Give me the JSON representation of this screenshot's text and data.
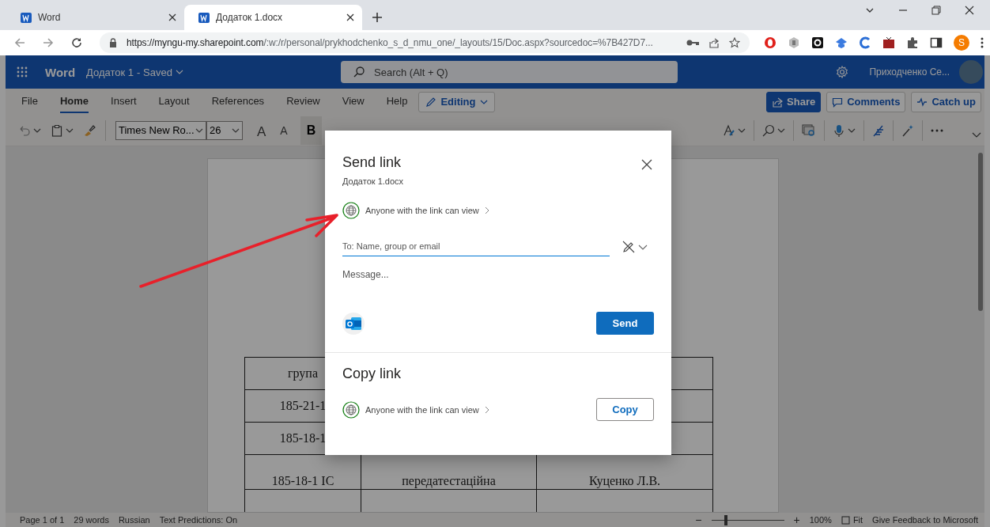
{
  "browser": {
    "tabs": [
      {
        "title": "Word",
        "selected": false
      },
      {
        "title": "Додаток 1.docx",
        "selected": true
      }
    ],
    "url_host": "https://myngu-my.sharepoint.com",
    "url_path": "/:w:/r/personal/prykhodchenko_s_d_nmu_one/_layouts/15/Doc.aspx?sourcedoc=%7B427D7...",
    "profile_letter": "S"
  },
  "header": {
    "app_name": "Word",
    "doc_title": "Додаток 1",
    "save_status": "- Saved",
    "search_placeholder": "Search (Alt + Q)",
    "user_name": "Приходченко Се..."
  },
  "ribbon_tabs": [
    {
      "label": "File",
      "selected": false
    },
    {
      "label": "Home",
      "selected": true
    },
    {
      "label": "Insert",
      "selected": false
    },
    {
      "label": "Layout",
      "selected": false
    },
    {
      "label": "References",
      "selected": false
    },
    {
      "label": "Review",
      "selected": false
    },
    {
      "label": "View",
      "selected": false
    },
    {
      "label": "Help",
      "selected": false
    }
  ],
  "mode_button": "Editing",
  "actions": [
    {
      "kind": "share",
      "label": "Share"
    },
    {
      "kind": "comments",
      "label": "Comments"
    },
    {
      "kind": "catchup",
      "label": "Catch up"
    }
  ],
  "toolbar": {
    "font_name": "Times New Ro...",
    "font_size": "26",
    "grow_font": "A",
    "shrink_font": "A",
    "bold": "B"
  },
  "document": {
    "table_rows": [
      [
        "група",
        "",
        ""
      ],
      [
        "185-21-1",
        "",
        ""
      ],
      [
        "185-18-1",
        "",
        ""
      ],
      [
        "185-18-1 ІС",
        "передатестаційна",
        "Куценко Л.В."
      ],
      [
        "",
        "",
        ""
      ]
    ]
  },
  "dialog": {
    "title": "Send link",
    "file_name": "Додаток 1.docx",
    "permission": "Anyone with the link can view",
    "to_placeholder": "To: Name, group or email",
    "message_placeholder": "Message...",
    "send_button": "Send",
    "copy_title": "Copy link",
    "copy_permission": "Anyone with the link can view",
    "copy_button": "Copy"
  },
  "status_bar": {
    "items": [
      "Page 1 of 1",
      "29 words",
      "Russian",
      "Text Predictions: On"
    ],
    "zoom_out": "−",
    "zoom_in": "+",
    "zoom": {
      "level": 0.2
    },
    "zoom_percent": "100%",
    "fit": "Fit",
    "feedback": "Give Feedback to Microsoft"
  }
}
